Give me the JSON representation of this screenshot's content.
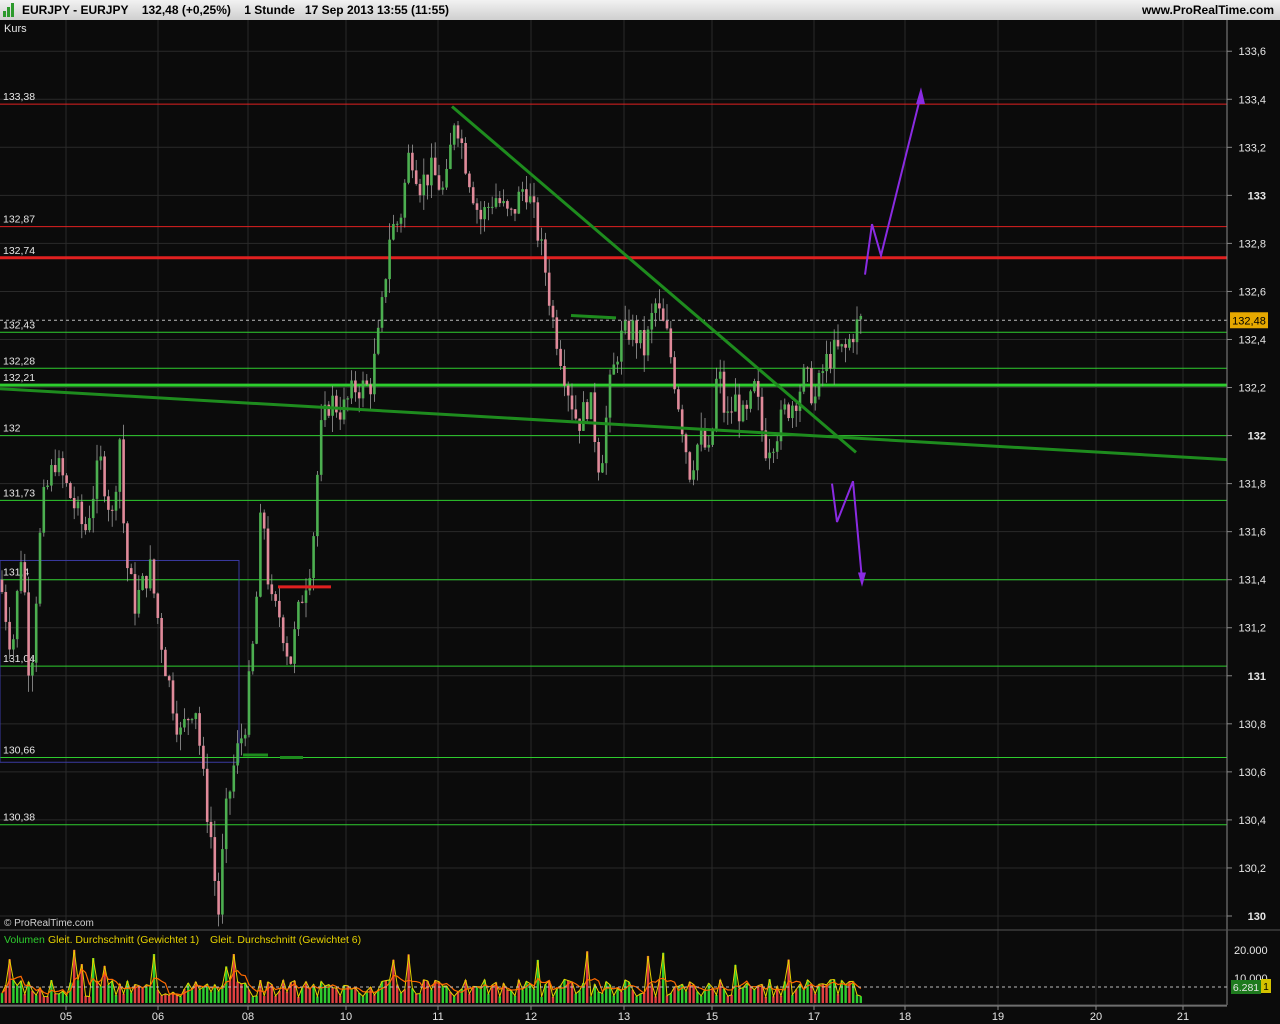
{
  "header": {
    "instrument": "EURJPY - EURJPY",
    "last_change": "132,48 (+0,25%)",
    "timeframe": "1 Stunde",
    "datetime": "17 Sep 2013 13:55 (11:55)",
    "site": "www.ProRealTime.com"
  },
  "price_panel": {
    "label": "Kurs",
    "copyright": "© ProRealTime.com",
    "current_price": "132,48"
  },
  "volume_panel": {
    "label_volume": "Volumen",
    "label_ma1": "Gleit. Durchschnitt (Gewichtet 1)",
    "label_ma6": "Gleit. Durchschnitt (Gewichtet 6)",
    "axis_top": "20.000",
    "axis_mid": "10.000",
    "current_value": "6.281",
    "current_badge": "1"
  },
  "colors": {
    "background": "#0b0b0b",
    "grid": "#2a2a2a",
    "up_candle": "#4caf50",
    "down_candle": "#e08a9a",
    "support_line": "#2ecc2e",
    "resistance_line": "#e02020",
    "trend_line": "#1e8c1e",
    "projection_arrow": "#8a2be2",
    "current_price_badge": "#e6a800",
    "box": "#3a3aa0",
    "volume_ma": "#e6d200",
    "volume_ma6": "#ff6a00"
  },
  "chart_data": {
    "type": "candlestick",
    "instrument": "EURJPY",
    "interval": "1 Stunde",
    "ylim": [
      129.95,
      133.73
    ],
    "y_ticks": [
      "133,6",
      "133,4",
      "133,2",
      "133",
      "132,8",
      "132,6",
      "132,4",
      "132,2",
      "132",
      "131,8",
      "131,6",
      "131,4",
      "131,2",
      "131",
      "130,8",
      "130,6",
      "130,4",
      "130,2",
      "130"
    ],
    "x_ticks": [
      "05",
      "06",
      "08",
      "10",
      "11",
      "12",
      "13",
      "15",
      "17",
      "18",
      "19",
      "20",
      "21"
    ],
    "price_path": [
      [
        0,
        131.4
      ],
      [
        12,
        131.1
      ],
      [
        22,
        131.55
      ],
      [
        30,
        130.95
      ],
      [
        42,
        131.7
      ],
      [
        55,
        131.9
      ],
      [
        70,
        131.75
      ],
      [
        85,
        131.6
      ],
      [
        100,
        131.9
      ],
      [
        112,
        131.65
      ],
      [
        120,
        132.0
      ],
      [
        125,
        131.5
      ],
      [
        135,
        131.3
      ],
      [
        150,
        131.45
      ],
      [
        165,
        131.05
      ],
      [
        180,
        130.75
      ],
      [
        195,
        130.9
      ],
      [
        205,
        130.5
      ],
      [
        212,
        130.3
      ],
      [
        218,
        129.98
      ],
      [
        225,
        130.4
      ],
      [
        235,
        130.65
      ],
      [
        245,
        130.8
      ],
      [
        255,
        131.2
      ],
      [
        262,
        131.75
      ],
      [
        270,
        131.3
      ],
      [
        280,
        131.25
      ],
      [
        290,
        131.05
      ],
      [
        300,
        131.3
      ],
      [
        312,
        131.5
      ],
      [
        320,
        132.0
      ],
      [
        330,
        132.15
      ],
      [
        342,
        132.1
      ],
      [
        355,
        132.2
      ],
      [
        370,
        132.2
      ],
      [
        380,
        132.45
      ],
      [
        390,
        132.85
      ],
      [
        400,
        132.9
      ],
      [
        410,
        133.2
      ],
      [
        420,
        133.05
      ],
      [
        432,
        133.1
      ],
      [
        445,
        133.0
      ],
      [
        455,
        133.35
      ],
      [
        465,
        133.15
      ],
      [
        480,
        132.9
      ],
      [
        495,
        133.0
      ],
      [
        510,
        132.9
      ],
      [
        525,
        133.05
      ],
      [
        535,
        132.9
      ],
      [
        545,
        132.7
      ],
      [
        552,
        132.5
      ],
      [
        560,
        132.35
      ],
      [
        568,
        132.2
      ],
      [
        578,
        132.05
      ],
      [
        590,
        132.15
      ],
      [
        600,
        131.85
      ],
      [
        610,
        132.2
      ],
      [
        620,
        132.4
      ],
      [
        632,
        132.45
      ],
      [
        645,
        132.35
      ],
      [
        655,
        132.55
      ],
      [
        668,
        132.4
      ],
      [
        680,
        132.1
      ],
      [
        690,
        131.85
      ],
      [
        700,
        132.0
      ],
      [
        710,
        131.9
      ],
      [
        718,
        132.3
      ],
      [
        726,
        132.05
      ],
      [
        735,
        132.15
      ],
      [
        745,
        132.05
      ],
      [
        755,
        132.2
      ],
      [
        765,
        131.95
      ],
      [
        775,
        132.0
      ],
      [
        785,
        132.1
      ],
      [
        795,
        132.15
      ],
      [
        805,
        132.25
      ],
      [
        815,
        132.15
      ],
      [
        825,
        132.3
      ],
      [
        835,
        132.35
      ],
      [
        845,
        132.35
      ],
      [
        855,
        132.45
      ],
      [
        862,
        132.48
      ]
    ],
    "horizontal_levels": [
      {
        "label": "133,38",
        "value": 133.38,
        "color": "red",
        "width": 1
      },
      {
        "label": "132,87",
        "value": 132.87,
        "color": "red",
        "width": 1
      },
      {
        "label": "132,74",
        "value": 132.74,
        "color": "red",
        "width": 3
      },
      {
        "label": "132,43",
        "value": 132.43,
        "color": "green",
        "width": 1
      },
      {
        "label": "132,28",
        "value": 132.28,
        "color": "green",
        "width": 1
      },
      {
        "label": "132,21",
        "value": 132.21,
        "color": "green",
        "width": 3
      },
      {
        "label": "132",
        "value": 132.0,
        "color": "green",
        "width": 1
      },
      {
        "label": "131,73",
        "value": 131.73,
        "color": "green",
        "width": 1
      },
      {
        "label": "131,4",
        "value": 131.4,
        "color": "green",
        "width": 1
      },
      {
        "label": "131,04",
        "value": 131.04,
        "color": "green",
        "width": 1
      },
      {
        "label": "130,66",
        "value": 130.66,
        "color": "green",
        "width": 1
      },
      {
        "label": "130,38",
        "value": 130.38,
        "color": "green",
        "width": 1
      }
    ],
    "current_price": 132.48
  }
}
